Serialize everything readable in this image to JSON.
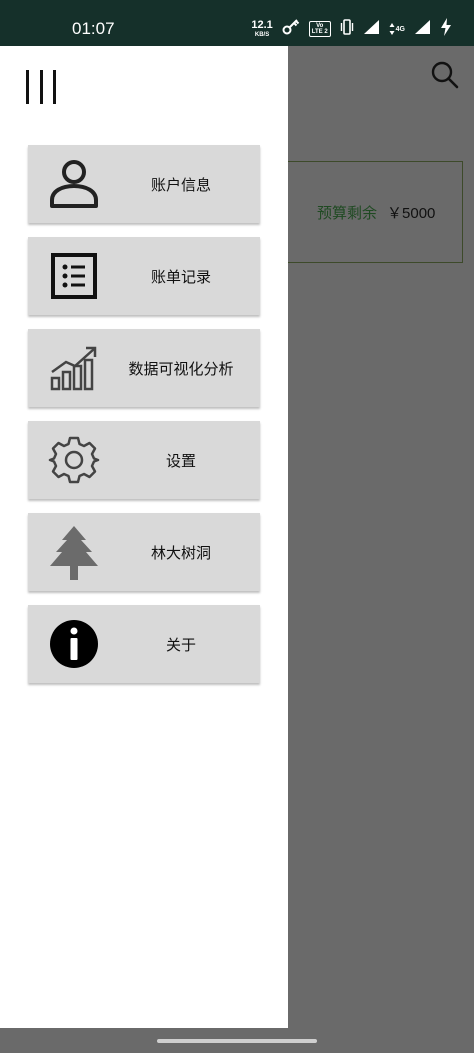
{
  "status_bar": {
    "time": "01:07",
    "network_speed_value": "12.1",
    "network_speed_unit": "KB/S",
    "volte_line1": "Vo",
    "volte_line2": "LTE 2",
    "network_type": "4G",
    "icons": [
      "key-icon",
      "vibrate-icon",
      "signal-icon",
      "data-arrows-icon",
      "signal-icon",
      "charging-icon"
    ]
  },
  "background": {
    "budget_label": "预算剩余",
    "budget_amount": "￥5000",
    "icons": [
      "search-icon"
    ]
  },
  "drawer": {
    "menu_icon": "hamburger-menu-icon",
    "items": [
      {
        "label": "账户信息",
        "icon": "person-icon"
      },
      {
        "label": "账单记录",
        "icon": "list-icon"
      },
      {
        "label": "数据可视化分析",
        "icon": "chart-icon"
      },
      {
        "label": "设置",
        "icon": "gear-icon"
      },
      {
        "label": "林大树洞",
        "icon": "tree-icon"
      },
      {
        "label": "关于",
        "icon": "info-icon"
      }
    ]
  },
  "colors": {
    "status_bar_bg": "#15302a",
    "scrim": "#6a6a6a",
    "drawer_bg": "#ffffff",
    "menu_item_bg": "#d9d9d9",
    "budget_label": "#1f4a22"
  }
}
